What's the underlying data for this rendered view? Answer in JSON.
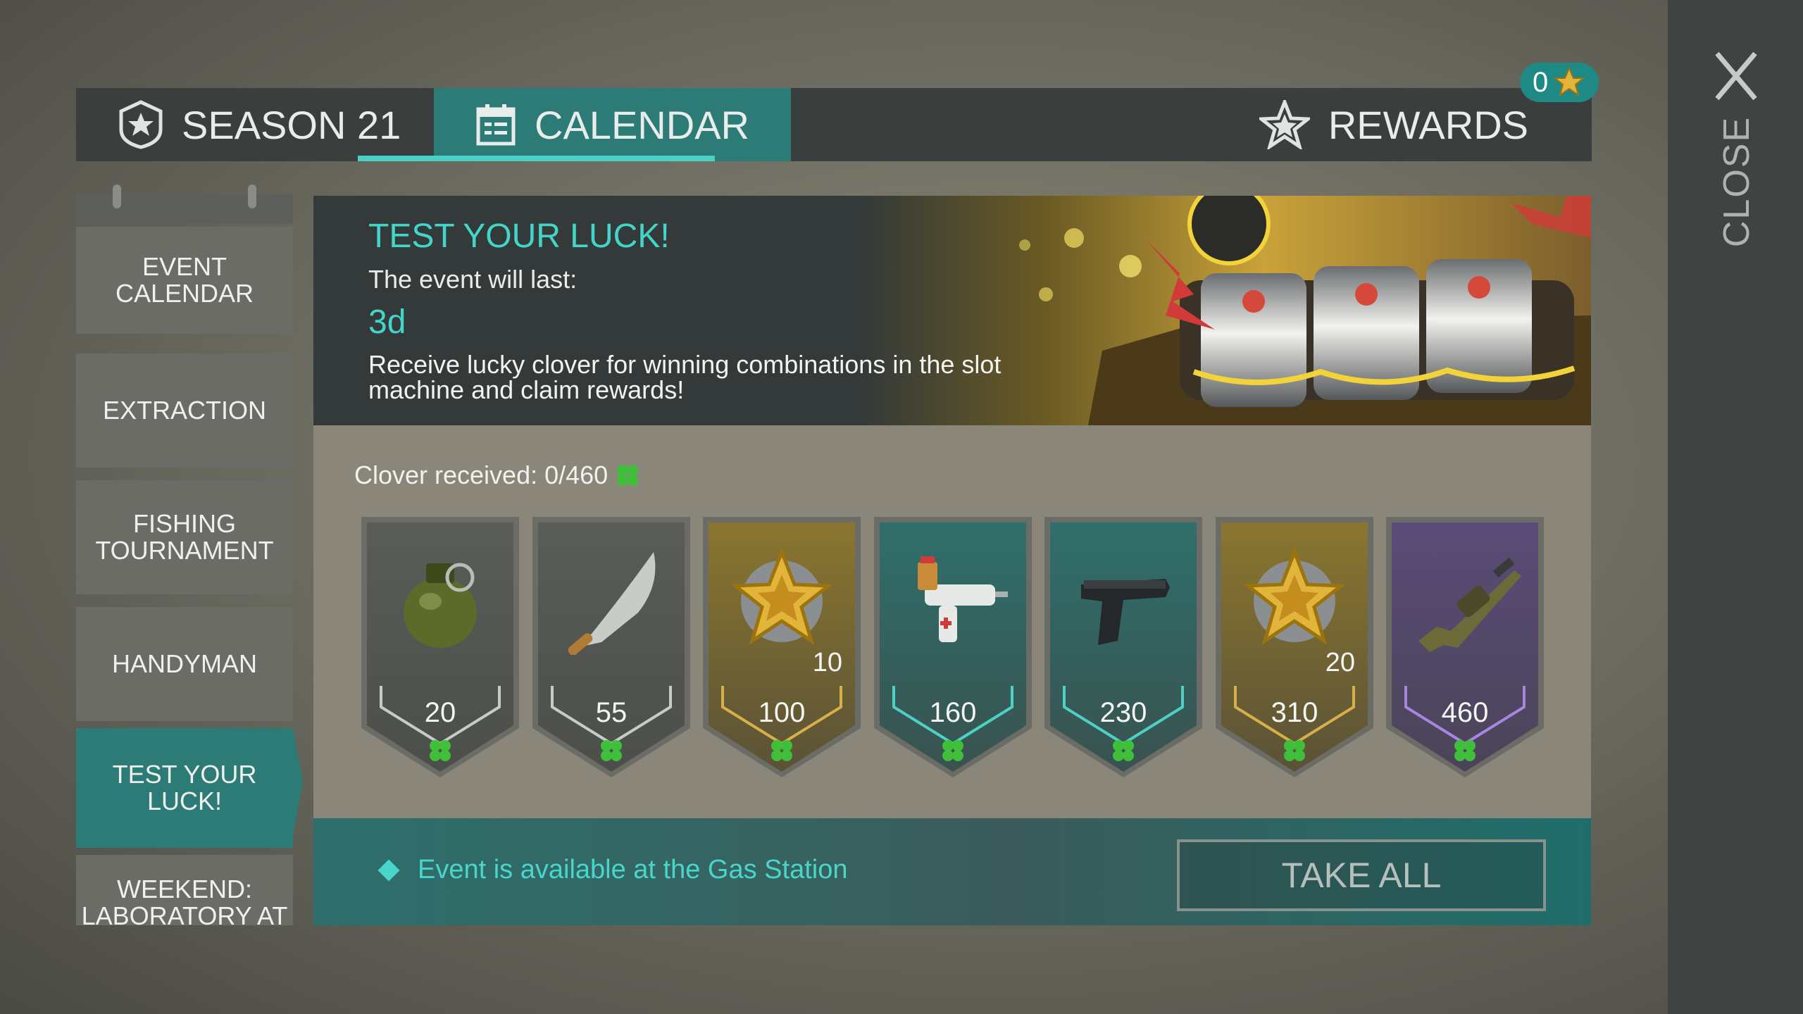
{
  "close": {
    "label": "CLOSE"
  },
  "tabs": [
    {
      "label": "SEASON 21",
      "icon": "season-shield-icon",
      "selected": false
    },
    {
      "label": "CALENDAR",
      "icon": "calendar-icon",
      "selected": true
    },
    {
      "label": "REWARDS",
      "icon": "star-icon",
      "selected": false
    }
  ],
  "rewards_badge": {
    "count": "0"
  },
  "sidebar": {
    "items": [
      {
        "label": "EVENT CALENDAR",
        "selected": false
      },
      {
        "label": "EXTRACTION",
        "selected": false
      },
      {
        "label": "FISHING\nTOURNAMENT",
        "selected": false
      },
      {
        "label": "HANDYMAN",
        "selected": false
      },
      {
        "label": "TEST YOUR LUCK!",
        "selected": true
      },
      {
        "label": "WEEKEND:\nLABORATORY AT",
        "selected": false
      }
    ]
  },
  "event": {
    "title": "TEST YOUR LUCK!",
    "duration_label": "The event will last:",
    "duration": "3d",
    "description": "Receive lucky clover for winning combinations in the slot machine and claim rewards!"
  },
  "progress": {
    "label": "Clover received: 0/460",
    "current": 0,
    "max": 460
  },
  "rewards": [
    {
      "threshold": "20",
      "item": "grenade-icon",
      "qty": "",
      "tier": "gray"
    },
    {
      "threshold": "55",
      "item": "machete-icon",
      "qty": "",
      "tier": "gray"
    },
    {
      "threshold": "100",
      "item": "gold-star-token-icon",
      "qty": "10",
      "tier": "gold"
    },
    {
      "threshold": "160",
      "item": "syringe-gun-icon",
      "qty": "",
      "tier": "teal"
    },
    {
      "threshold": "230",
      "item": "pistol-icon",
      "qty": "",
      "tier": "teal"
    },
    {
      "threshold": "310",
      "item": "gold-star-token-icon",
      "qty": "20",
      "tier": "gold"
    },
    {
      "threshold": "460",
      "item": "grenade-launcher-icon",
      "qty": "",
      "tier": "purple"
    }
  ],
  "footer": {
    "availability": "Event is available at the Gas Station",
    "take_all_label": "TAKE ALL"
  },
  "colors": {
    "accent": "#44d5ca",
    "tab_active": "#2c7b77",
    "clover": "#3fbf3a"
  }
}
